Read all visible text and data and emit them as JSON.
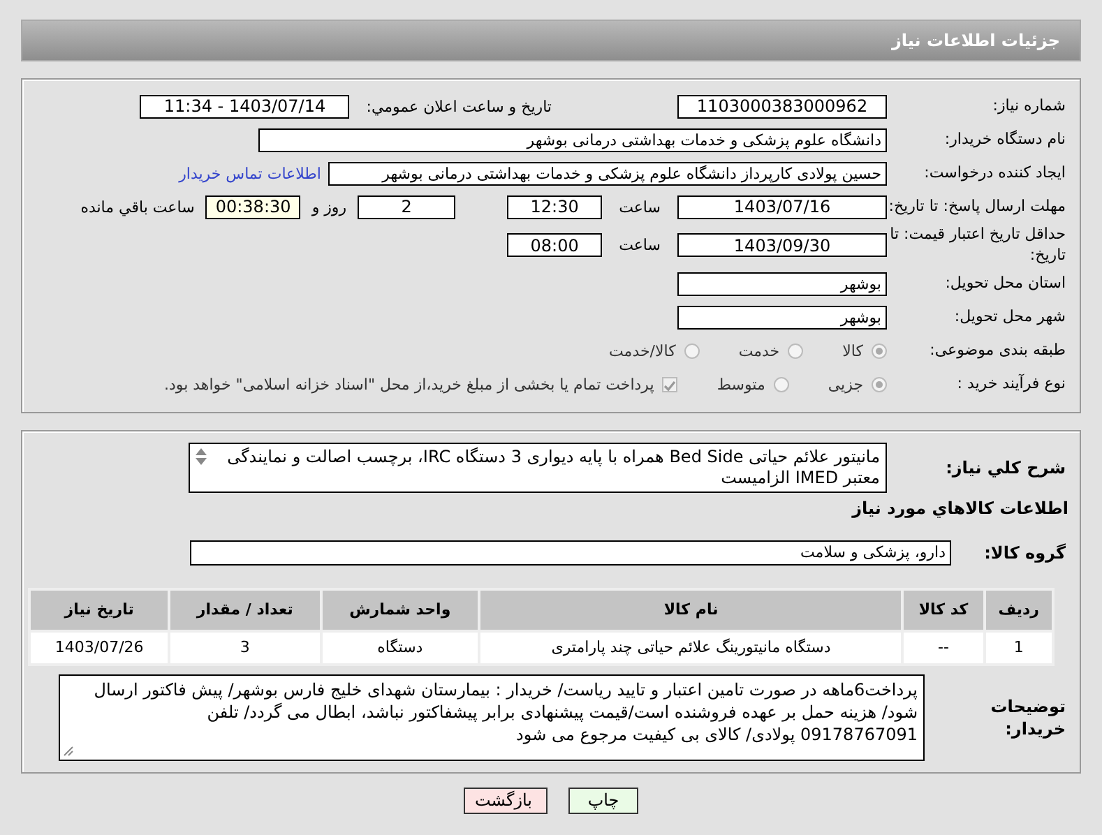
{
  "header": {
    "title": "جزئیات اطلاعات نیاز"
  },
  "details": {
    "need_number": {
      "label": "شماره نیاز:",
      "value": "1103000383000962"
    },
    "announce": {
      "label": "تاریخ و ساعت اعلان عمومي:",
      "value": "1403/07/14 - 11:34"
    },
    "buyer": {
      "label": "نام دستگاه خریدار:",
      "value": "دانشگاه علوم پزشکی و خدمات بهداشتی درمانی بوشهر"
    },
    "requester": {
      "label": "ایجاد کننده درخواست:",
      "value": "حسین پولادی کارپرداز دانشگاه علوم پزشکی و خدمات بهداشتی درمانی بوشهر",
      "link": "اطلاعات تماس خریدار"
    },
    "deadline": {
      "label": "مهلت ارسال پاسخ: تا تاریخ:",
      "date": "1403/07/16",
      "time_label": "ساعت",
      "time": "12:30",
      "days": "2",
      "days_label": "روز و",
      "remaining": "00:38:30",
      "remaining_label": "ساعت باقي مانده"
    },
    "validity": {
      "label": "حداقل تاریخ اعتبار قیمت: تا تاریخ:",
      "date": "1403/09/30",
      "time_label": "ساعت",
      "time": "08:00"
    },
    "province": {
      "label": "استان محل تحویل:",
      "value": "بوشهر"
    },
    "city": {
      "label": "شهر محل تحویل:",
      "value": "بوشهر"
    },
    "category": {
      "label": "طبقه بندی موضوعی:",
      "options": [
        {
          "label": "کالا",
          "selected": true
        },
        {
          "label": "خدمت",
          "selected": false
        },
        {
          "label": "کالا/خدمت",
          "selected": false
        }
      ]
    },
    "process": {
      "label": "نوع فرآیند خرید :",
      "options": [
        {
          "label": "جزیی",
          "selected": true
        },
        {
          "label": "متوسط",
          "selected": false
        }
      ],
      "treasury": {
        "label": "پرداخت تمام یا بخشی از مبلغ خرید،از محل \"اسناد خزانه اسلامی\" خواهد بود.",
        "checked": true
      }
    }
  },
  "needs": {
    "description": {
      "label": "شرح کلي نیاز:",
      "value": "مانیتور علائم حیاتی Bed Side همراه با پایه دیواری 3 دستگاه IRC، برچسب اصالت و نمایندگی معتبر IMED الزامیست"
    },
    "heading": "اطلاعات کالاهاي مورد نیاز",
    "goods_group": {
      "label": "گروه کالا:",
      "value": "دارو، پزشکی و سلامت"
    },
    "table": {
      "columns": [
        "ردیف",
        "کد کالا",
        "نام کالا",
        "واحد شمارش",
        "تعداد / مقدار",
        "تاریخ نیاز"
      ],
      "rows": [
        [
          "1",
          "--",
          "دستگاه مانیتورینگ علائم حیاتی چند پارامتری",
          "دستگاه",
          "3",
          "1403/07/26"
        ]
      ]
    },
    "buyer_notes": {
      "label": "توضیحات خریدار:",
      "value": "پرداخت6ماهه در صورت تامین اعتبار و تایید ریاست/ خریدار : بیمارستان شهدای خلیج فارس بوشهر/ پیش فاکتور ارسال شود/ هزینه حمل بر عهده فروشنده است/قیمت پیشنهادی برابر پیشفاکتور نباشد، ابطال می گردد/ تلفن 09178767091 پولادی/ کالای بی کیفیت مرجوع می شود"
    }
  },
  "buttons": [
    {
      "label": "چاپ",
      "kind": "print"
    },
    {
      "label": "بازگشت",
      "kind": "back"
    }
  ]
}
